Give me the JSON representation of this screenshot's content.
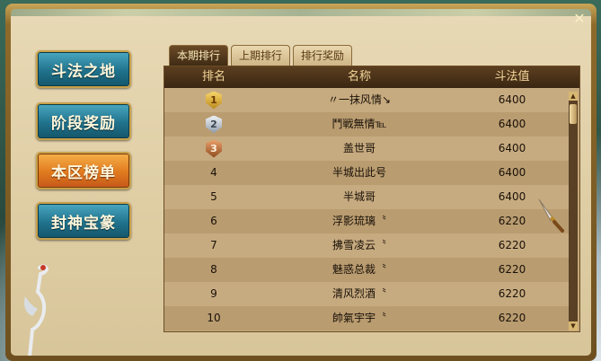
{
  "nav": {
    "items": [
      {
        "label": "斗法之地",
        "active": false
      },
      {
        "label": "阶段奖励",
        "active": false
      },
      {
        "label": "本区榜单",
        "active": true
      },
      {
        "label": "封神宝篆",
        "active": false
      }
    ]
  },
  "tabs": [
    {
      "label": "本期排行",
      "active": true
    },
    {
      "label": "上期排行",
      "active": false
    },
    {
      "label": "排行奖励",
      "active": false
    }
  ],
  "table": {
    "headers": {
      "rank": "排名",
      "name": "名称",
      "value": "斗法值"
    },
    "rows": [
      {
        "rank": "1",
        "medal": "gold",
        "name": "〃一抹风情↘",
        "value": "6400"
      },
      {
        "rank": "2",
        "medal": "silver",
        "name": "鬥戦無情℡",
        "value": "6400"
      },
      {
        "rank": "3",
        "medal": "bronze",
        "name": "盖世哥",
        "value": "6400"
      },
      {
        "rank": "4",
        "medal": "",
        "name": "半城出此号",
        "value": "6400"
      },
      {
        "rank": "5",
        "medal": "",
        "name": "半城哥",
        "value": "6400"
      },
      {
        "rank": "6",
        "medal": "",
        "name": "浮影琉璃〝",
        "value": "6220"
      },
      {
        "rank": "7",
        "medal": "",
        "name": "拂雪凌云〝",
        "value": "6220"
      },
      {
        "rank": "8",
        "medal": "",
        "name": "魅惑总裁〝",
        "value": "6220"
      },
      {
        "rank": "9",
        "medal": "",
        "name": "清风烈酒〝",
        "value": "6220"
      },
      {
        "rank": "10",
        "medal": "",
        "name": "帥氣宇宇〝",
        "value": "6220"
      }
    ]
  },
  "window": {
    "close": "✕"
  },
  "colors": {
    "accent": "#e07a1e",
    "nav": "#20728c",
    "header": "#3a2612"
  }
}
